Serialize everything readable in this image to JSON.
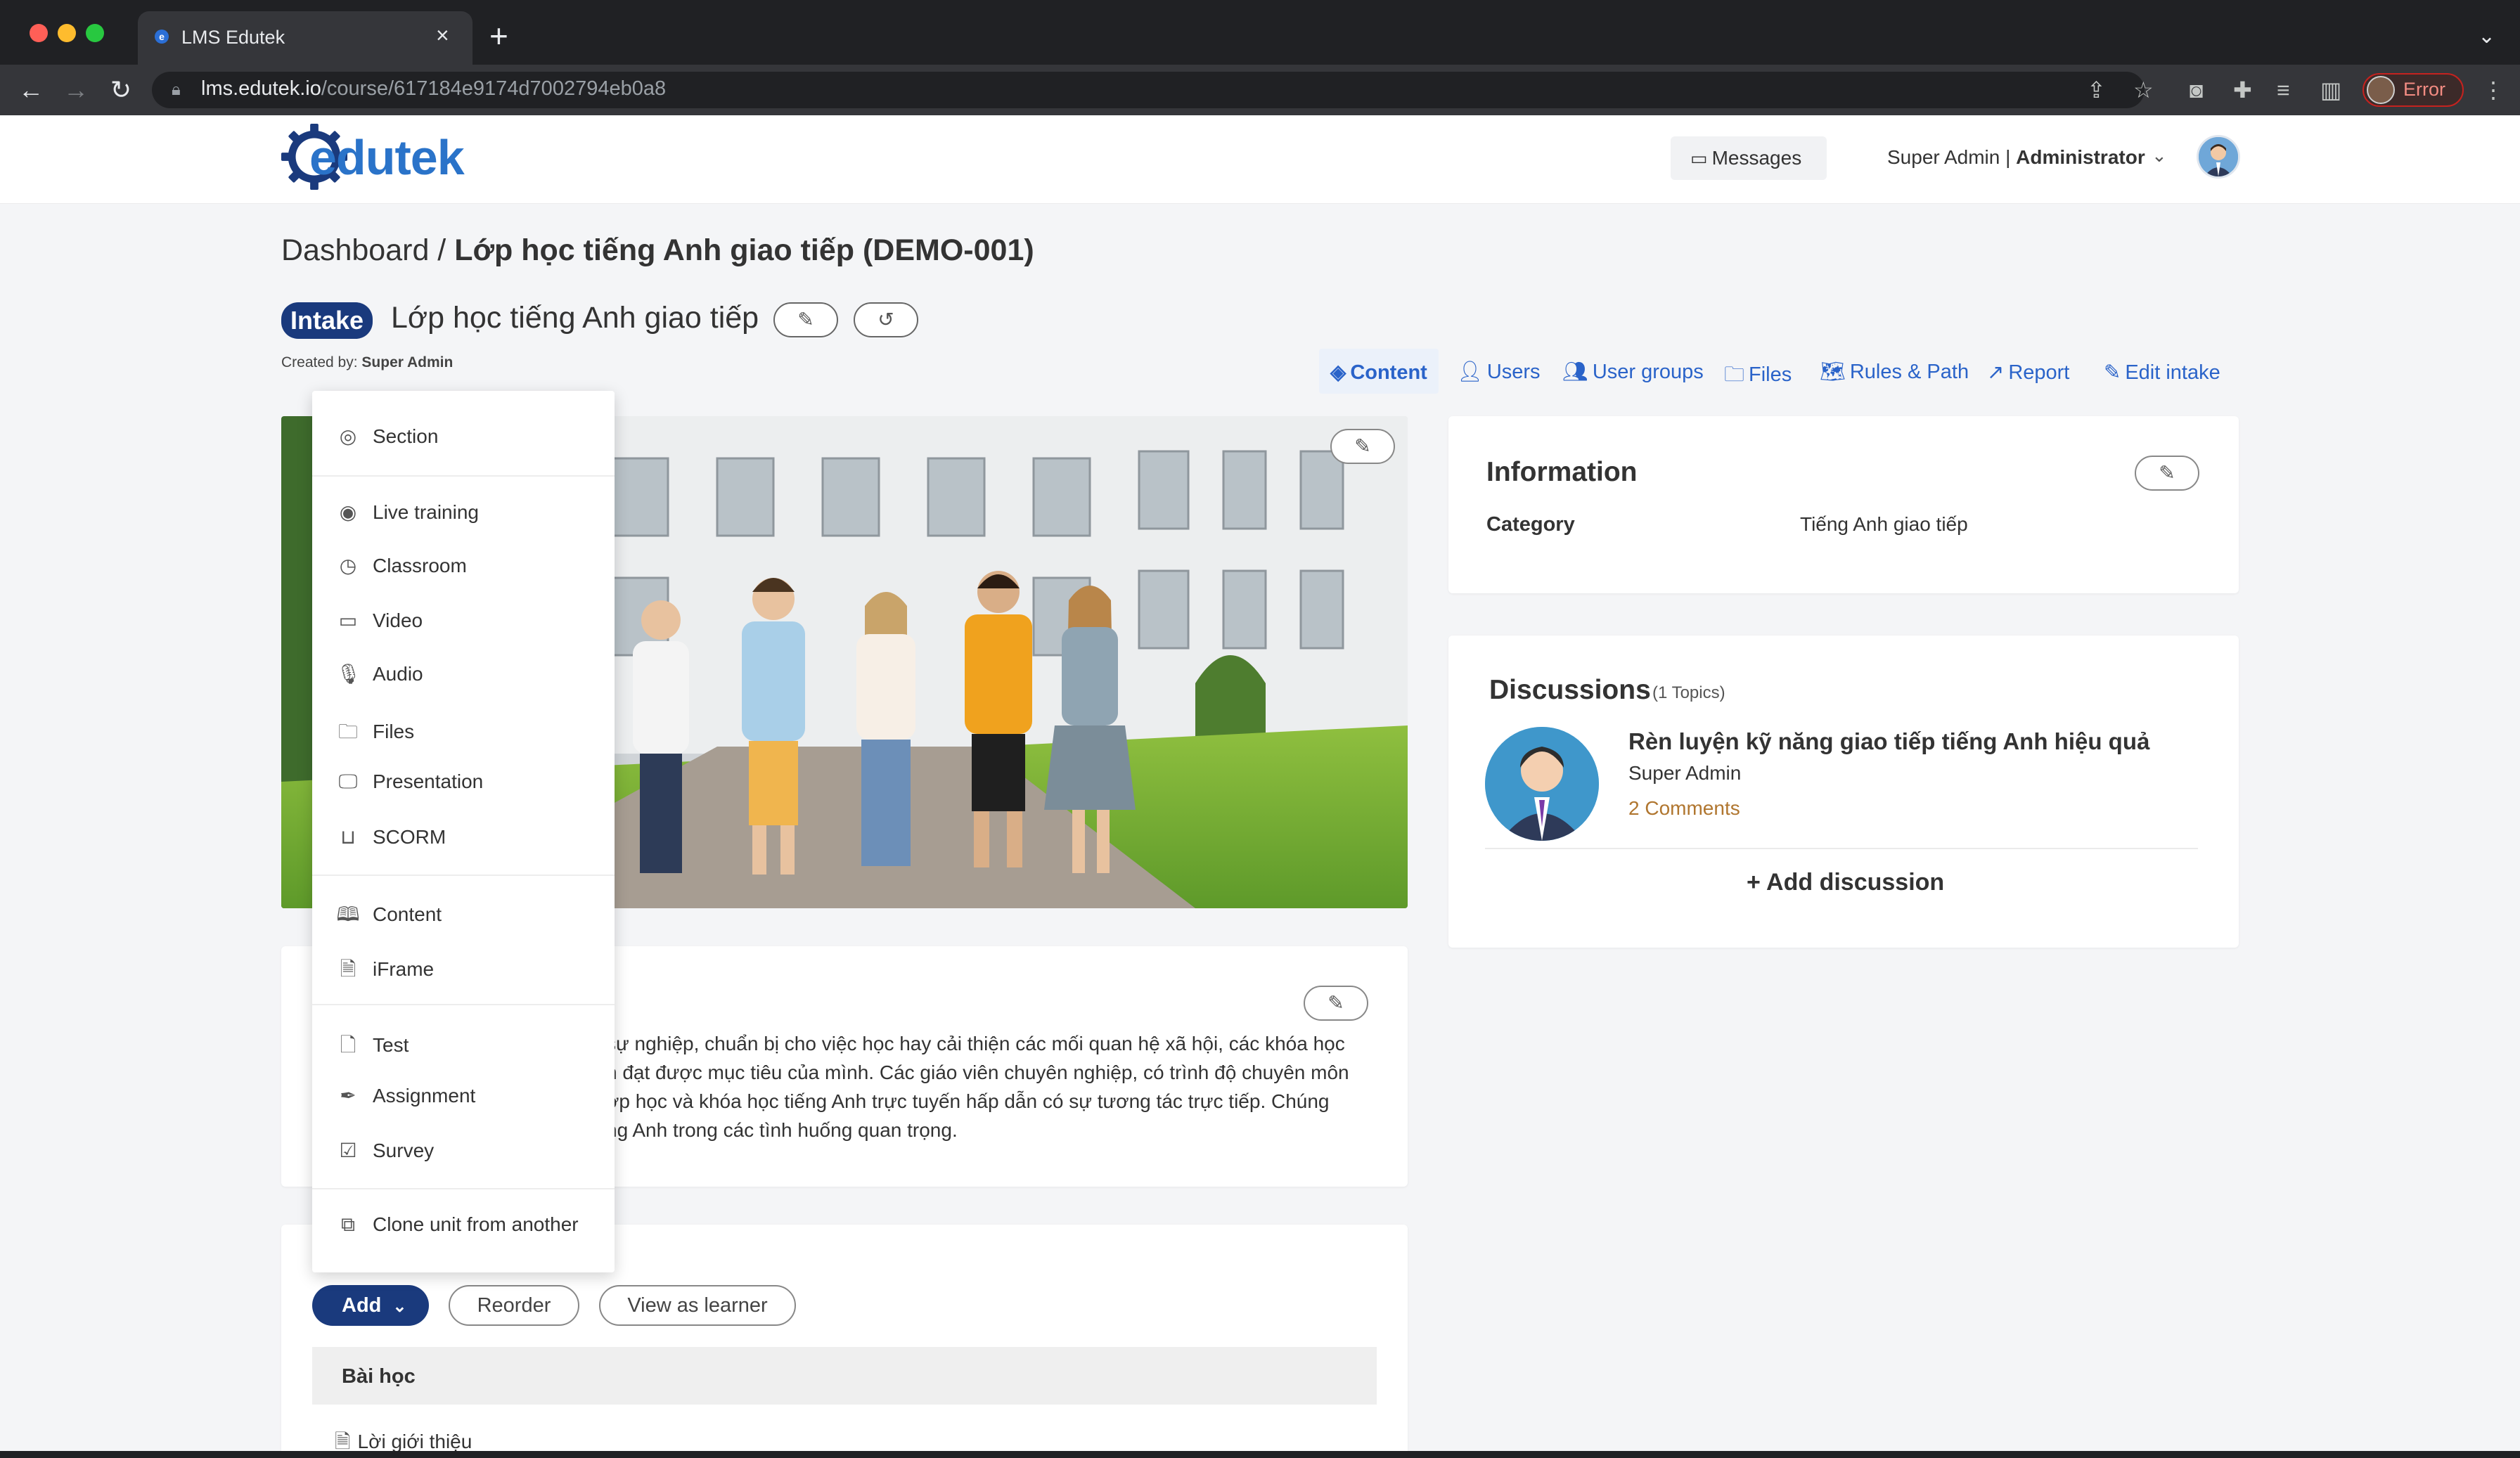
{
  "browser": {
    "tab_title": "LMS Edutek",
    "url_host": "lms.edutek.io",
    "url_path": "/course/617184e9174d7002794eb0a8",
    "profile_status": "Error"
  },
  "header": {
    "logo_text": "edutek",
    "messages_label": "Messages",
    "user_name": "Super Admin | ",
    "user_role": "Administrator"
  },
  "breadcrumb": {
    "root": "Dashboard / ",
    "current": "Lớp học tiếng Anh giao tiếp (DEMO-001)"
  },
  "course": {
    "badge": "Intake",
    "title": "Lớp học tiếng Anh giao tiếp",
    "created_by_label": "Created by: ",
    "created_by_name": "Super Admin"
  },
  "nav_tabs": [
    {
      "label": "Content",
      "icon": "layers-icon"
    },
    {
      "label": "Users",
      "icon": "user-icon"
    },
    {
      "label": "User groups",
      "icon": "users-icon"
    },
    {
      "label": "Files",
      "icon": "folder-icon"
    },
    {
      "label": "Rules & Path",
      "icon": "map-icon"
    },
    {
      "label": "Report",
      "icon": "trending-up-icon"
    },
    {
      "label": "Edit intake",
      "icon": "edit-icon"
    }
  ],
  "description": {
    "lines": [
      "sự nghiệp, chuẩn bị cho việc học hay cải thiện các mối quan hệ xã hội, các khóa học",
      "n đạt được mục tiêu của mình. Các giáo viên chuyên nghiệp, có trình độ chuyên môn",
      "ớp học và khóa học tiếng Anh trực tuyến hấp dẫn có sự tương tác trực tiếp. Chúng",
      "ng Anh trong các tình huống quan trọng."
    ]
  },
  "units": {
    "add_label": "Add",
    "reorder_label": "Reorder",
    "view_as_learner_label": "View as learner",
    "section_title": "Bài học",
    "first_lesson": "Lời giới thiệu"
  },
  "add_menu": {
    "items": [
      {
        "label": "Section",
        "icon": "compass-icon"
      },
      {
        "label": "Live training",
        "icon": "target-icon"
      },
      {
        "label": "Classroom",
        "icon": "clock-icon"
      },
      {
        "label": "Video",
        "icon": "video-icon"
      },
      {
        "label": "Audio",
        "icon": "microphone-icon"
      },
      {
        "label": "Files",
        "icon": "folder-icon"
      },
      {
        "label": "Presentation",
        "icon": "monitor-icon"
      },
      {
        "label": "SCORM",
        "icon": "inbox-icon"
      },
      {
        "label": "Content",
        "icon": "book-icon"
      },
      {
        "label": "iFrame",
        "icon": "file-text-icon"
      },
      {
        "label": "Test",
        "icon": "file-icon"
      },
      {
        "label": "Assignment",
        "icon": "pen-tool-icon"
      },
      {
        "label": "Survey",
        "icon": "check-square-icon"
      },
      {
        "label": "Clone unit from another",
        "icon": "copy-icon"
      }
    ]
  },
  "information": {
    "title": "Information",
    "category_label": "Category",
    "category_value": "Tiếng Anh giao tiếp"
  },
  "discussions": {
    "title": "Discussions",
    "count_label": "(1 Topics)",
    "topic_title": "Rèn luyện kỹ năng giao tiếp tiếng Anh hiệu quả",
    "topic_author": "Super Admin",
    "topic_comments": "2 Comments",
    "add_label": "+ Add discussion"
  },
  "colors": {
    "primary": "#1a3a7d",
    "link": "#2a63c9",
    "comments": "#b0762f"
  }
}
